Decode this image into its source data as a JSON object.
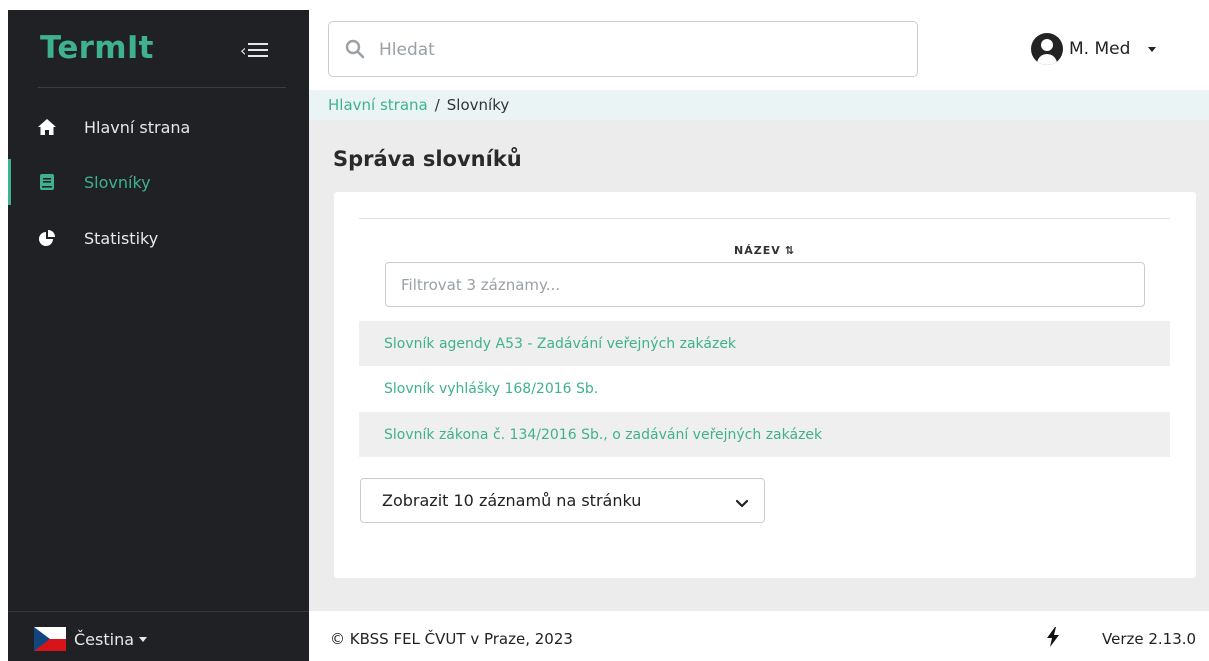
{
  "app": {
    "brand": "TermIt"
  },
  "sidebar": {
    "items": [
      {
        "label": "Hlavní strana",
        "icon": "home-icon",
        "active": false
      },
      {
        "label": "Slovníky",
        "icon": "book-icon",
        "active": true
      },
      {
        "label": "Statistiky",
        "icon": "pie-chart-icon",
        "active": false
      }
    ],
    "language": {
      "label": "Čestina",
      "icon": "czech-flag-icon"
    }
  },
  "header": {
    "search": {
      "placeholder": "Hledat"
    },
    "user": {
      "name": "M. Med"
    }
  },
  "breadcrumb": {
    "home": "Hlavní strana",
    "separator": "/",
    "current": "Slovníky"
  },
  "main": {
    "title": "Správa slovníků",
    "table": {
      "column": "NÁZEV",
      "filter_placeholder": "Filtrovat 3 záznamy...",
      "rows": [
        "Slovník agendy A53 - Zadávání veřejných zakázek",
        "Slovník vyhlášky 168/2016 Sb.",
        "Slovník zákona č. 134/2016 Sb., o zadávání veřejných zakázek"
      ]
    },
    "page_size": "Zobrazit 10 záznamů na stránku"
  },
  "footer": {
    "copyright": "© KBSS FEL ČVUT v Praze, 2023",
    "version": "Verze 2.13.0"
  },
  "colors": {
    "accent": "#3fb28d",
    "sidebar_bg": "#1f2124",
    "main_bg": "#ececec",
    "breadcrumb_bg": "#eaf4f4"
  }
}
